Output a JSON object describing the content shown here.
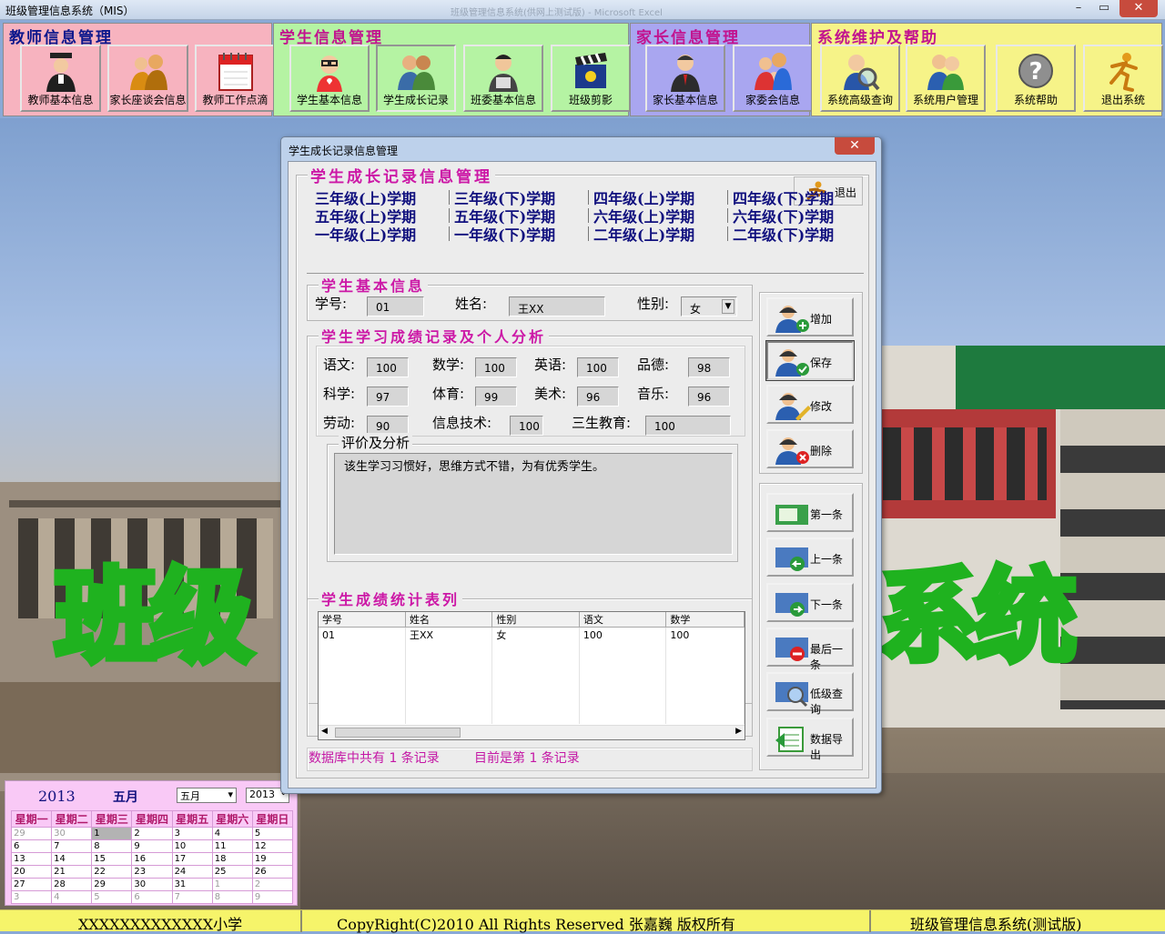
{
  "window": {
    "title": "班级管理信息系统（MIS）",
    "background_caption": "班级管理信息系统(供网上测试版) - Microsoft Excel"
  },
  "toolbar": {
    "groups": [
      {
        "label": "教师信息管理",
        "color": "#f7b3bf",
        "buttons": [
          "教师基本信息",
          "家长座谈会信息",
          "教师工作点滴"
        ]
      },
      {
        "label": "学生信息管理",
        "color": "#b5f3a3",
        "buttons": [
          "学生基本信息",
          "学生成长记录",
          "班委基本信息",
          "班级剪影"
        ]
      },
      {
        "label": "家长信息管理",
        "color": "#a9a6f0",
        "buttons": [
          "家长基本信息",
          "家委会信息"
        ]
      },
      {
        "label": "系统维护及帮助",
        "color": "#f6f388",
        "buttons": [
          "系统高级查询",
          "系统用户管理",
          "系统帮助",
          "退出系统"
        ]
      }
    ]
  },
  "background": {
    "watermark_left": "班级",
    "watermark_right": "系统"
  },
  "calendar": {
    "year": "2013",
    "month_label": "五月",
    "month_select": "五月",
    "year_select": "2013",
    "weekdays": [
      "星期一",
      "星期二",
      "星期三",
      "星期四",
      "星期五",
      "星期六",
      "星期日"
    ],
    "rows": [
      [
        "29",
        "30",
        "1",
        "2",
        "3",
        "4",
        "5"
      ],
      [
        "6",
        "7",
        "8",
        "9",
        "10",
        "11",
        "12"
      ],
      [
        "13",
        "14",
        "15",
        "16",
        "17",
        "18",
        "19"
      ],
      [
        "20",
        "21",
        "22",
        "23",
        "24",
        "25",
        "26"
      ],
      [
        "27",
        "28",
        "29",
        "30",
        "31",
        "1",
        "2"
      ],
      [
        "3",
        "4",
        "5",
        "6",
        "7",
        "8",
        "9"
      ]
    ]
  },
  "status": {
    "school": "XXXXXXXXXXXXX小学",
    "copyright": "CopyRight(C)2010  All Rights Reserved 张嘉巍  版权所有",
    "system": "班级管理信息系统(测试版)"
  },
  "dialog": {
    "title": "学生成长记录信息管理",
    "close": "✕",
    "heading": "学生成长记录信息管理",
    "exit_label": "退出",
    "tabs": [
      [
        "三年级(上)学期",
        "三年级(下)学期",
        "四年级(上)学期",
        "四年级(下)学期"
      ],
      [
        "五年级(上)学期",
        "五年级(下)学期",
        "六年级(上)学期",
        "六年级(下)学期"
      ],
      [
        "一年级(上)学期",
        "一年级(下)学期",
        "二年级(上)学期",
        "二年级(下)学期"
      ]
    ],
    "basic": {
      "legend": "学生基本信息",
      "id_label": "学号:",
      "id_value": "01",
      "name_label": "姓名:",
      "name_value": "王XX",
      "gender_label": "性别:",
      "gender_value": "女"
    },
    "scores": {
      "legend": "学生学习成绩记录及个人分析",
      "items": [
        {
          "label": "语文:",
          "value": "100"
        },
        {
          "label": "数学:",
          "value": "100"
        },
        {
          "label": "英语:",
          "value": "100"
        },
        {
          "label": "品德:",
          "value": "98"
        },
        {
          "label": "科学:",
          "value": "97"
        },
        {
          "label": "体育:",
          "value": "99"
        },
        {
          "label": "美术:",
          "value": "96"
        },
        {
          "label": "音乐:",
          "value": "96"
        },
        {
          "label": "劳动:",
          "value": "90"
        },
        {
          "label": "信息技术:",
          "value": "100"
        },
        {
          "label": "三生教育:",
          "value": "100"
        }
      ],
      "comment_legend": "评价及分析",
      "comment": "该生学习习惯好，思维方式不错，为有优秀学生。"
    },
    "stats": {
      "legend": "学生成绩统计表列",
      "columns": [
        "学号",
        "姓名",
        "性别",
        "语文",
        "数学"
      ],
      "rows": [
        [
          "01",
          "王XX",
          "女",
          "100",
          "100"
        ]
      ]
    },
    "record_count": "数据库中共有 1 条记录",
    "record_current": "目前是第 1 条记录",
    "action_buttons": [
      "增加",
      "保存",
      "修改",
      "删除"
    ],
    "nav_buttons": [
      "第一条",
      "上一条",
      "下一条",
      "最后一条",
      "低级查询",
      "数据导出"
    ]
  }
}
